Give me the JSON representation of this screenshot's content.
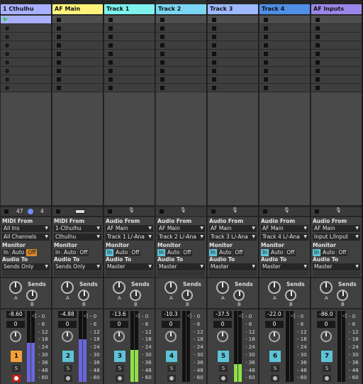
{
  "tracks": [
    {
      "name": "1 Cthulhu",
      "color": "#a8b0ff",
      "type": "midi",
      "hl": true,
      "io_title": "MIDI From",
      "from": "All Ins",
      "from2": "All Channels",
      "monitor_active": "Off",
      "audio_to": "Sends Only",
      "vol": "-8.60",
      "pan": "0",
      "num": "1",
      "num_color": "#f2a13a",
      "status_left": "47",
      "status_right": "4",
      "meter_fill": 0.55,
      "meter_color": "#6a66e0",
      "arm": true
    },
    {
      "name": "AF Main",
      "color": "#fff27a",
      "type": "midi",
      "io_title": "MIDI From",
      "from": "1-Cthulhu",
      "from2": "Cthulhu",
      "monitor_active": "",
      "audio_to": "Sends Only",
      "vol": "-4.88",
      "pan": "0",
      "num": "2",
      "num_color": "#5ec3d6",
      "meter_fill": 0.6,
      "meter_color": "#6a66e0",
      "arm": false
    },
    {
      "name": "Track 1",
      "color": "#7ff2ee",
      "type": "audio",
      "io_title": "Audio From",
      "from": "AF Main",
      "from2": "Track 1 L/-Ana",
      "monitor_active": "In",
      "audio_to": "Master",
      "vol": "-13.6",
      "pan": "0",
      "num": "3",
      "num_color": "#5ec3d6",
      "meter_fill": 0.45,
      "meter_color": "#8fe04a",
      "arm": false
    },
    {
      "name": "Track 2",
      "color": "#7ad6f2",
      "type": "audio",
      "selected": true,
      "io_title": "Audio From",
      "from": "AF Main",
      "from2": "Track 2 L/-Ana",
      "monitor_active": "In",
      "audio_to": "Master",
      "vol": "-10.3",
      "pan": "0",
      "num": "4",
      "num_color": "#5ec3d6",
      "meter_fill": 0.0,
      "meter_color": "#8fe04a",
      "arm": false
    },
    {
      "name": "Track 3",
      "color": "#9eb9ff",
      "type": "audio",
      "io_title": "Audio From",
      "from": "AF Main",
      "from2": "Track 3 L/-Ana",
      "monitor_active": "In",
      "audio_to": "Master",
      "vol": "-37.5",
      "pan": "0",
      "num": "5",
      "num_color": "#5ec3d6",
      "meter_fill": 0.25,
      "meter_color": "#8fe04a",
      "arm": false
    },
    {
      "name": "Track 4",
      "color": "#4f8fe6",
      "type": "audio",
      "io_title": "Audio From",
      "from": "AF Main",
      "from2": "Track 4 L/-Ana",
      "monitor_active": "In",
      "audio_to": "Master",
      "vol": "-22.0",
      "pan": "0",
      "num": "6",
      "num_color": "#5ec3d6",
      "meter_fill": 0.0,
      "meter_color": "#8fe04a",
      "arm": false
    },
    {
      "name": "AF Inputs",
      "color": "#9a86e8",
      "type": "audio",
      "io_title": "Audio From",
      "from": "AF Main",
      "from2": "Input L/Input",
      "monitor_active": "In",
      "audio_to": "Master",
      "vol": "-86.0",
      "pan": "0",
      "num": "7",
      "num_color": "#5ec3d6",
      "meter_fill": 0.0,
      "meter_color": "#8fe04a",
      "arm": false
    }
  ],
  "labels": {
    "monitor": "Monitor",
    "audio_to": "Audio To",
    "sends": "Sends",
    "send_a": "A",
    "send_b": "B",
    "in": "In",
    "auto": "Auto",
    "off": "Off",
    "solo": "S"
  },
  "db_scale": [
    "0",
    "6",
    "12",
    "18",
    "24",
    "30",
    "36",
    "48",
    "60"
  ]
}
